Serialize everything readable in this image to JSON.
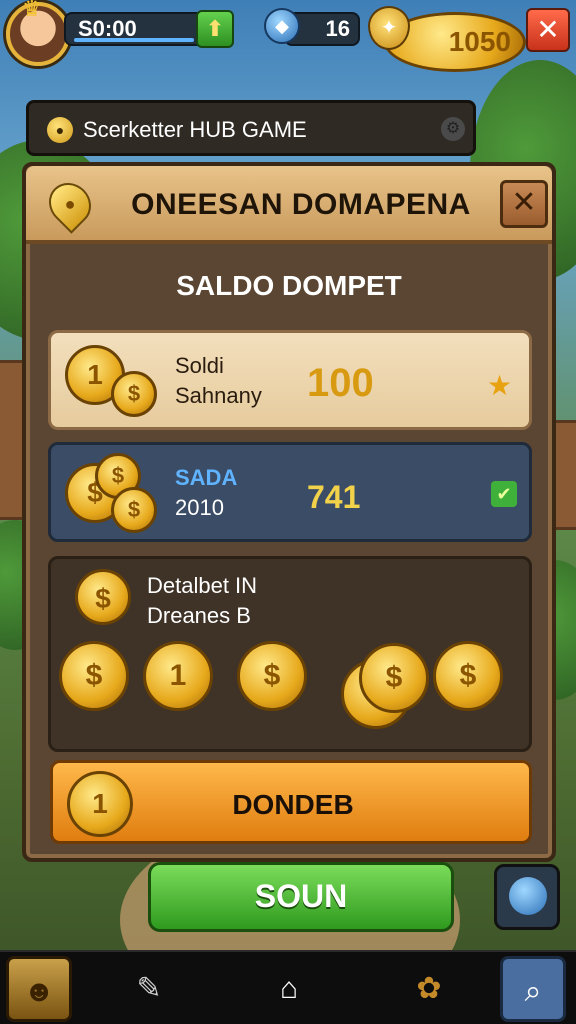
{
  "topbar": {
    "gold_value": "S0:00",
    "gem_value": "16",
    "coin_value": "1050",
    "plus_icon": "plus-icon",
    "close_icon": "close-icon"
  },
  "hub": {
    "title": "Scerketter HUB GAME"
  },
  "panel": {
    "title": "ONEESAN DOMAPENA",
    "section_title": "SALDO DOMPET",
    "card1": {
      "label_top": "Soldi",
      "label_bottom": "Sahnany",
      "value": "100"
    },
    "card2": {
      "label_top": "SADA",
      "label_bottom": "2010",
      "value": "741"
    },
    "detail": {
      "line1": "Detalbet IN",
      "line2": "Dreanes B"
    },
    "orange_button_label": "DONDEB"
  },
  "green_button_label": "SOUN",
  "colors": {
    "accent_gold": "#e7a91c",
    "accent_green": "#2f9a1f",
    "panel_brown": "#5a4632",
    "card_blue": "#3b4d66"
  }
}
